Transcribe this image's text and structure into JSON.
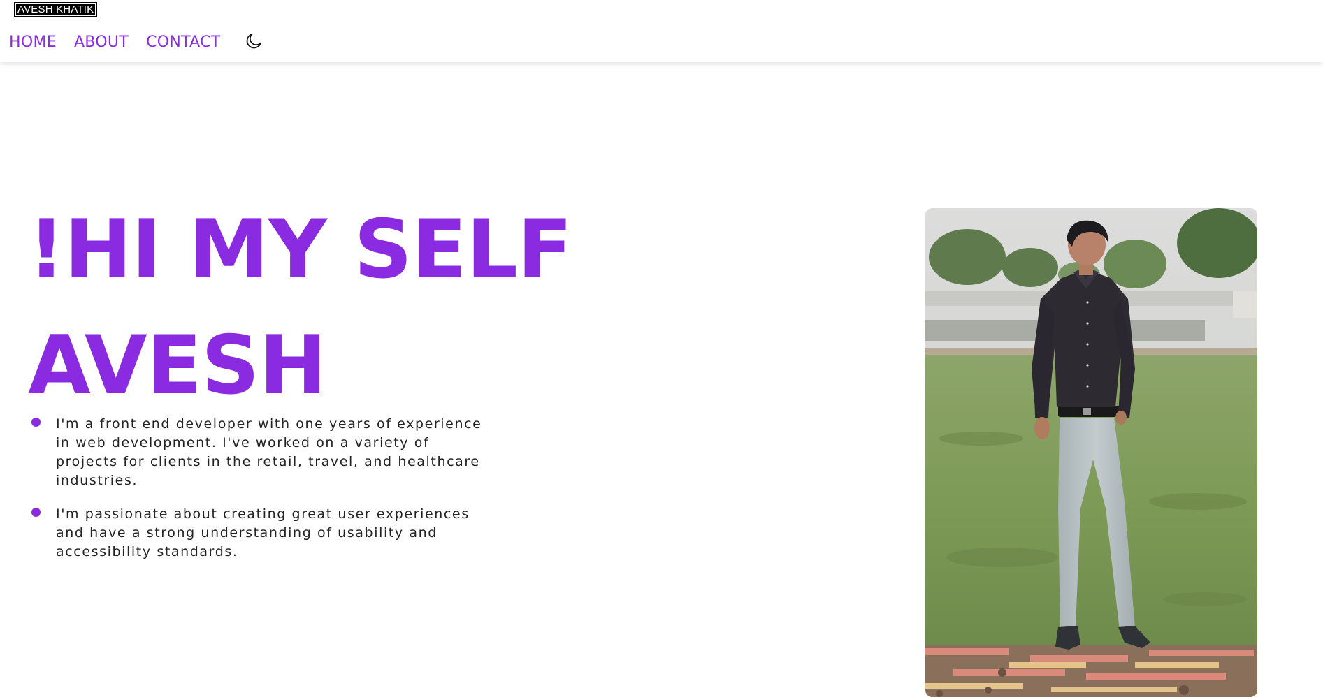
{
  "header": {
    "logo_text": "AVESH KHATIK",
    "nav": [
      {
        "label": "HOME"
      },
      {
        "label": "ABOUT"
      },
      {
        "label": "CONTACT"
      }
    ],
    "theme_toggle_icon": "moon-icon"
  },
  "hero": {
    "title_line1": "!HI MY SELF",
    "title_line2": "AVESH",
    "bullets": [
      "I'm a front end developer with one years of experience in web development. I've worked on a variety of projects for clients in the retail, travel, and healthcare industries.",
      "I'm passionate about creating great user experiences and have a strong understanding of usability and accessibility standards."
    ],
    "photo_icon": "profile-photo"
  },
  "colors": {
    "accent": "#8a2be2",
    "text": "#222222",
    "background": "#ffffff"
  }
}
